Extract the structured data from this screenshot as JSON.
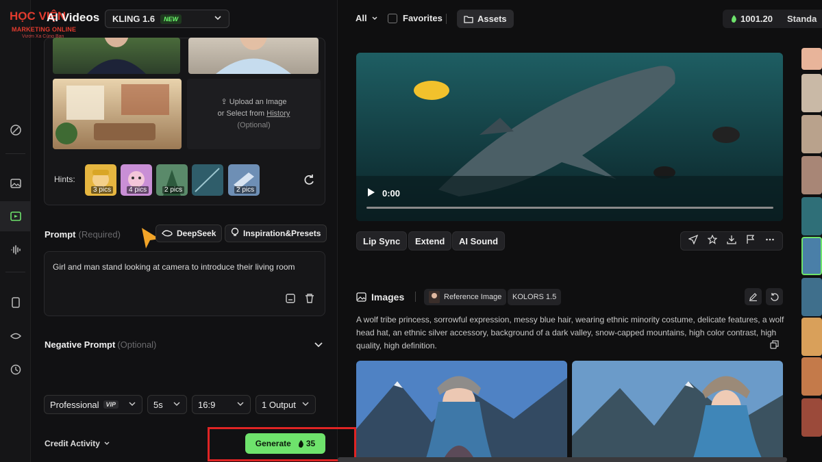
{
  "brand": {
    "logo_main": "HỌC VIỆN",
    "logo_sub": "MARKETING ONLINE",
    "logo_tag": "Vươn Xa Cùng Bạn"
  },
  "app_title": "AI Videos",
  "model": {
    "name": "KLING 1.6",
    "badge": "NEW"
  },
  "rail_icons": [
    "magic-wand-icon",
    "image-icon",
    "video-icon",
    "audio-wave-icon",
    "cube-icon",
    "eye-icon",
    "history-icon"
  ],
  "image_panel": {
    "upload_label": "Upload an Image",
    "select_prefix": "or Select from",
    "select_link": "History",
    "optional": "(Optional)"
  },
  "hints": {
    "label": "Hints:",
    "items": [
      {
        "count": "3 pics",
        "color": "#e6b640"
      },
      {
        "count": "4 pics",
        "color": "#c98fd6"
      },
      {
        "count": "2 pics",
        "color": "#5a8a6a"
      },
      {
        "count": "",
        "color": "#2f5d6a"
      },
      {
        "count": "2 pics",
        "color": "#6e8fb5"
      }
    ]
  },
  "prompt": {
    "label": "Prompt",
    "required": "(Required)",
    "deepseek": "DeepSeek",
    "inspiration": "Inspiration&Presets",
    "text": "Girl and man stand looking at camera to introduce their living room"
  },
  "negative_prompt": {
    "label": "Negative Prompt",
    "optional": "(Optional)"
  },
  "settings": {
    "mode": "Professional",
    "mode_badge": "VIP",
    "duration": "5s",
    "ratio": "16:9",
    "outputs": "1 Output"
  },
  "footer": {
    "credit_activity": "Credit Activity",
    "generate": "Generate",
    "cost": "35"
  },
  "topbar": {
    "filter": "All",
    "favorites": "Favorites",
    "assets": "Assets",
    "credits": "1001.20",
    "plan": "Standa"
  },
  "video": {
    "time": "0:00",
    "progress": 0
  },
  "video_actions": [
    "Lip Sync",
    "Extend",
    "AI Sound"
  ],
  "images_section": {
    "title": "Images",
    "reference_chip": "Reference Image",
    "model_chip": "KOLORS 1.5",
    "description": "A wolf tribe princess, sorrowful expression, messy blue hair, wearing ethnic minority costume, delicate features, a wolf head hat, an ethnic silver accessory, background of a dark valley, snow-capped mountains, high color contrast, high quality, high definition."
  },
  "colors": {
    "accent_green": "#6ee36c",
    "highlight_red": "#e02424",
    "background": "#0f0f10"
  }
}
